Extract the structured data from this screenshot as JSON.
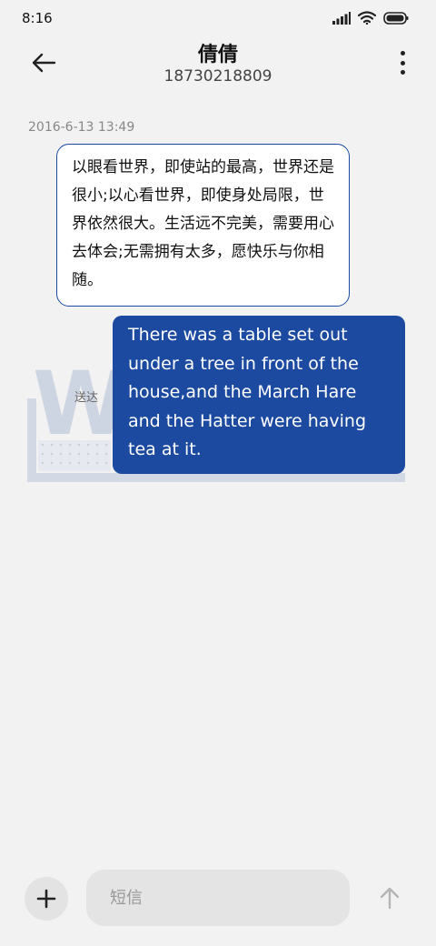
{
  "status_bar": {
    "time": "8:16"
  },
  "header": {
    "contact_name": "倩倩",
    "contact_number": "18730218809"
  },
  "conversation": {
    "timestamp": "2016-6-13 13:49",
    "received_message": "以眼看世界，即使站的最高，世界还是很小;以心看世界，即使身处局限，世界依然很大。生活远不完美，需要用心去体会;无需拥有太多，愿快乐与你相随。",
    "sent_status": "送达",
    "sent_message": "There was a table set out under a tree in front of the house,and the March Hare and the Hatter were having tea at it.",
    "watermark_letter": "W"
  },
  "composer": {
    "placeholder": "短信"
  },
  "colors": {
    "accent": "#1c4aa1",
    "background": "#f2f2f2"
  },
  "icons": {
    "back": "arrow-left-icon",
    "more": "more-vertical-icon",
    "add": "plus-icon",
    "send": "arrow-up-icon",
    "signal": "signal-icon",
    "wifi": "wifi-icon",
    "battery": "battery-icon"
  }
}
